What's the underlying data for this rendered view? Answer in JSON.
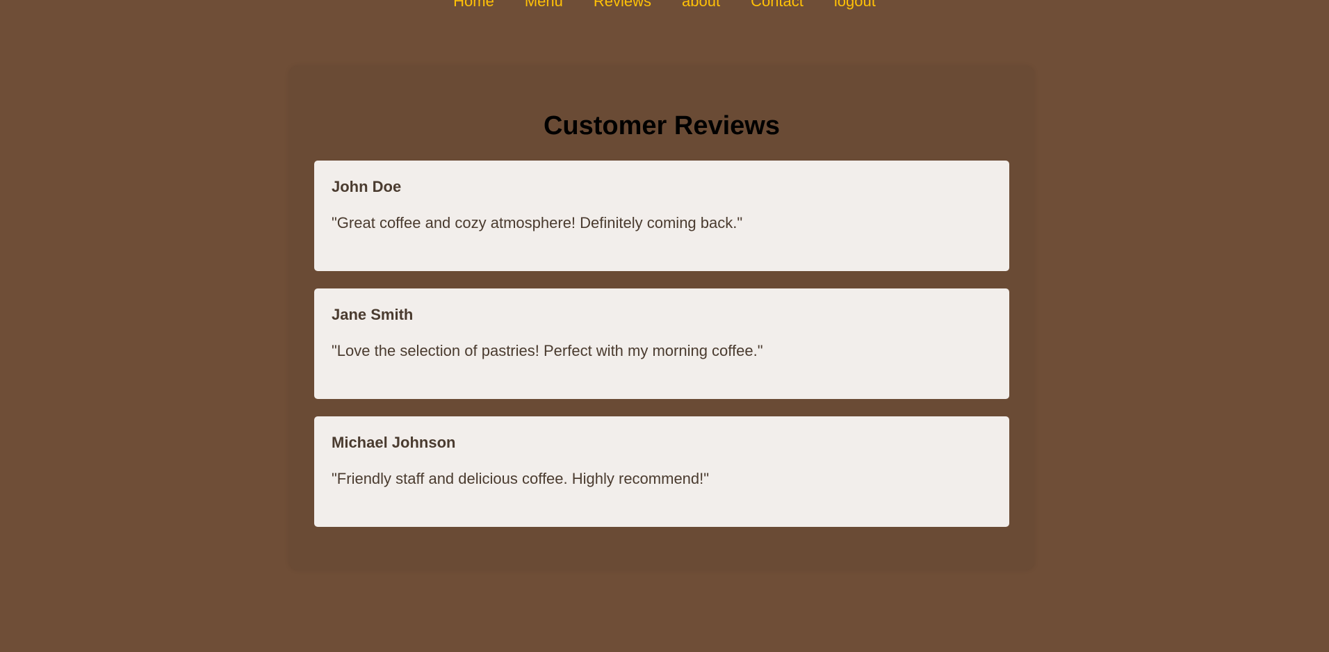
{
  "nav": {
    "items": [
      {
        "label": "Home"
      },
      {
        "label": "Menu"
      },
      {
        "label": "Reviews"
      },
      {
        "label": "about"
      },
      {
        "label": "Contact"
      },
      {
        "label": "logout"
      }
    ]
  },
  "main": {
    "title": "Customer Reviews",
    "reviews": [
      {
        "name": "John Doe",
        "text": "\"Great coffee and cozy atmosphere! Definitely coming back.\""
      },
      {
        "name": "Jane Smith",
        "text": "\"Love the selection of pastries! Perfect with my morning coffee.\""
      },
      {
        "name": "Michael Johnson",
        "text": "\"Friendly staff and delicious coffee. Highly recommend!\""
      }
    ]
  },
  "colors": {
    "background": "#6f4e37",
    "nav_link": "#ffc107",
    "card": "#f2eeeb",
    "card_text": "#4a3b2f"
  }
}
